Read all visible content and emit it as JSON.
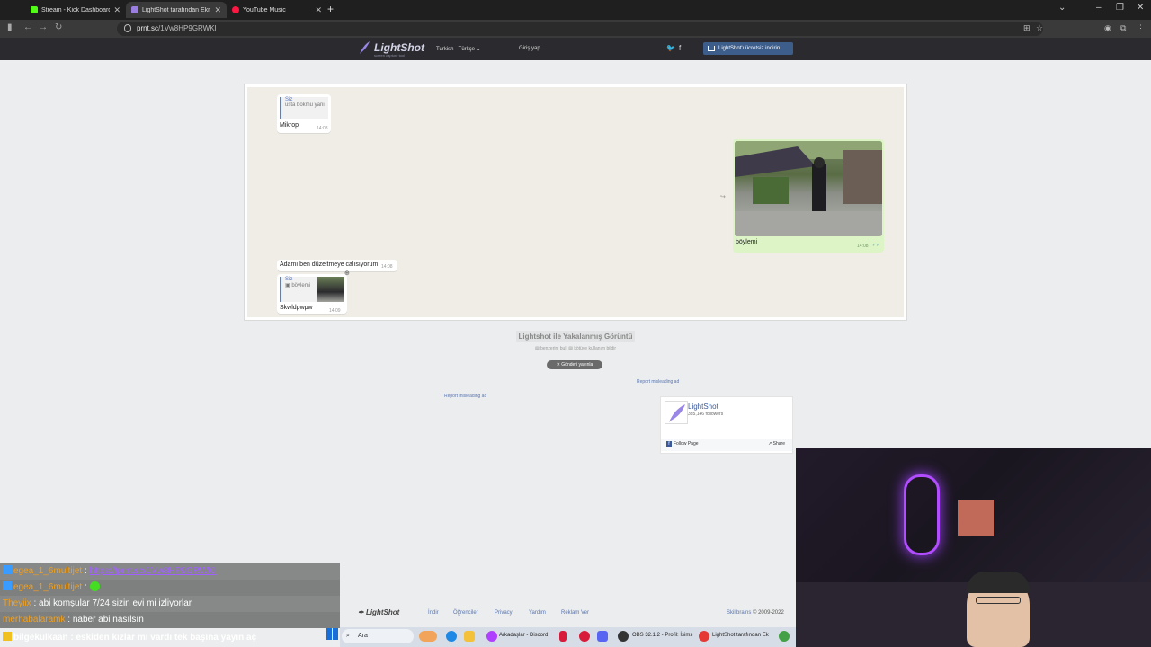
{
  "browser": {
    "tabs": [
      {
        "label": "Stream - Kick Dashboard",
        "color": "#53fc18"
      },
      {
        "label": "LightShot tarafından Ekran Görü",
        "color": "#9b7fe0"
      },
      {
        "label": "YouTube Music",
        "color": "#ff1744"
      }
    ],
    "url_host": "prnt.sc",
    "url_path": "/1Vw8HP9GRWKI"
  },
  "lightshot": {
    "logo": "LightShot",
    "tagline": "screen capture tool",
    "language": "Turkish - Türkçe",
    "login": "Giriş yap",
    "download_button": "LightShot'ı ücretsiz indirin",
    "caption_title": "Lightshot ile Yakalanmış Görüntü",
    "caption_similar": "benzerini bul",
    "caption_report": "kötüye kullanım bildir",
    "tweet": "Gönderi yayınla",
    "report_ad": "Report misleading ad",
    "fb": {
      "name": "LightShot",
      "followers": "385,146 followers",
      "follow": "Follow Page",
      "share": "Share"
    },
    "footer": {
      "logo": "LightShot",
      "links": [
        "İndir",
        "Öğrenciler",
        "Privacy",
        "Yardım",
        "Reklam Ver"
      ],
      "company": "Skillbrains",
      "copyright": " © 2009-2022"
    }
  },
  "chat_shot": {
    "msg1": {
      "quote_name": "Siz",
      "quote_text": "usta bokmu yani",
      "text": "Mikrop",
      "time": "14:08"
    },
    "video": {
      "caption": "böylemi",
      "time": "14:08"
    },
    "msg2": {
      "text": "Adamı ben düzeltmeye calısıyorum",
      "time": "14:08"
    },
    "msg3": {
      "quote_name": "Siz",
      "quote_text": "böylemi",
      "text": "Skwldpwpw",
      "time": "14:09"
    }
  },
  "stream_chat": [
    {
      "user": "egea_1_6multijet",
      "text": "https://prnt.sc/1Vw8HP9GRWKI",
      "type": "link"
    },
    {
      "user": "egea_1_6multijet",
      "text": "",
      "type": "emote"
    },
    {
      "user": "Theyiix",
      "text": "abi komşular 7/24 sizin evi mi izliyorlar",
      "type": "text"
    },
    {
      "user": "merhabalaramk",
      "text": "naber abi nasılsın",
      "type": "text"
    }
  ],
  "chat_last": {
    "user": "bilgekulkaan",
    "text": " : eskiden kızlar mı vardı tek başına yayın aç"
  },
  "taskbar": {
    "search": "Ara",
    "discord": "Arkadaşlar - Discord",
    "obs": "OBS 32.1.2 - Profil: İsims",
    "lightshot": "LightShot tarafından Ek"
  }
}
